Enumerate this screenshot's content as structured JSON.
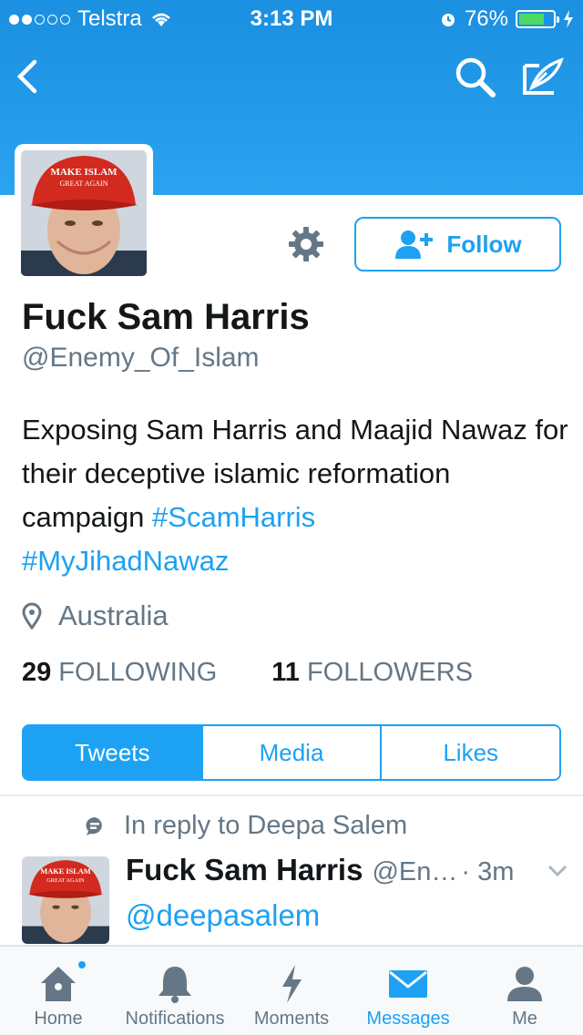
{
  "status_bar": {
    "carrier": "Telstra",
    "time": "3:13 PM",
    "battery": "76%",
    "battery_level": 0.76
  },
  "profile": {
    "avatar_hat_text_1": "MAKE ISLAM",
    "avatar_hat_text_2": "GREAT AGAIN",
    "display_name": "Fuck Sam Harris",
    "handle": "@Enemy_Of_Islam",
    "bio_text": "Exposing Sam Harris and Maajid Nawaz for their deceptive islamic reformation campaign ",
    "bio_tag_1": "#ScamHarris",
    "bio_tag_2": "#MyJihadNawaz",
    "location": "Australia",
    "following_count": "29",
    "following_label": "FOLLOWING",
    "followers_count": "11",
    "followers_label": "FOLLOWERS",
    "follow_label": "Follow"
  },
  "tabs": [
    "Tweets",
    "Media",
    "Likes"
  ],
  "tweet": {
    "reply_context": "In reply to Deepa Salem",
    "name": "Fuck Sam Harris",
    "handle": "@En…",
    "time": "· 3m",
    "text": "@deepasalem"
  },
  "tabbar": [
    {
      "label": "Home",
      "icon": "home-icon"
    },
    {
      "label": "Notifications",
      "icon": "bell-icon"
    },
    {
      "label": "Moments",
      "icon": "lightning-icon"
    },
    {
      "label": "Messages",
      "icon": "envelope-icon"
    },
    {
      "label": "Me",
      "icon": "person-icon"
    }
  ],
  "colors": {
    "accent": "#1da1f2",
    "header": "#2aa3f0",
    "muted": "#657786"
  }
}
